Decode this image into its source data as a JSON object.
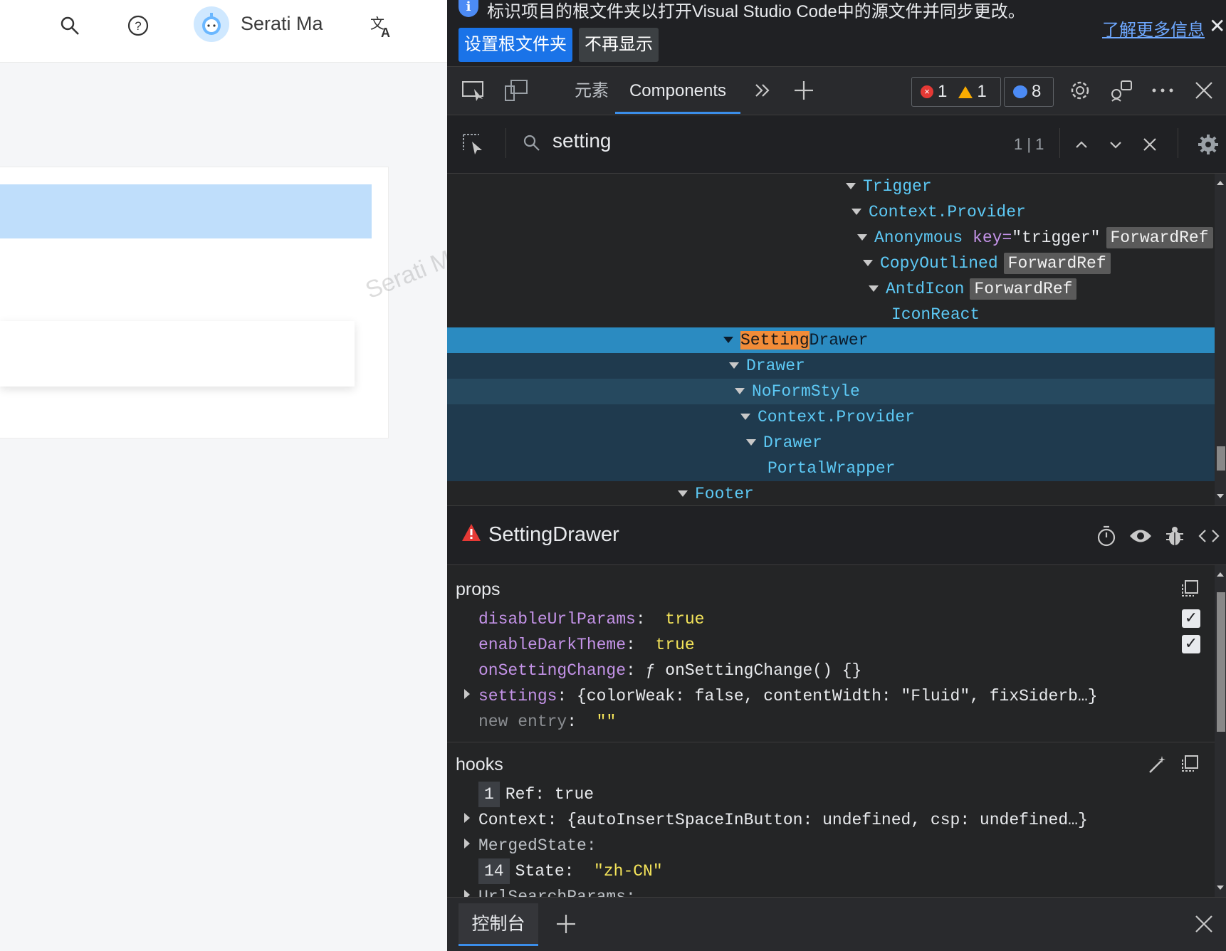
{
  "app": {
    "username": "Serati Ma",
    "watermark": "Serati M"
  },
  "devtools": {
    "infobar": {
      "message": "标识项目的根文件夹以打开Visual Studio Code中的源文件并同步更改。",
      "set_root_button": "设置根文件夹",
      "dont_show_button": "不再显示",
      "learn_more_link": "了解更多信息"
    },
    "tabs": {
      "elements": "元素",
      "components": "Components"
    },
    "badges": {
      "errors": "1",
      "warnings": "1",
      "messages": "8"
    },
    "search": {
      "query": "setting",
      "count": "1 | 1"
    },
    "tree": {
      "trigger": "Trigger",
      "context_provider_1": "Context.Provider",
      "anonymous": "Anonymous",
      "key_attr": "key=",
      "key_value": "\"trigger\"",
      "forward_ref": "ForwardRef",
      "copy_outlined": "CopyOutlined",
      "antd_icon": "AntdIcon",
      "icon_react": "IconReact",
      "setting_match": "Setting",
      "drawer_rest": "Drawer",
      "drawer_1": "Drawer",
      "no_form_style": "NoFormStyle",
      "context_provider_2": "Context.Provider",
      "drawer_2": "Drawer",
      "portal_wrapper": "PortalWrapper",
      "footer": "Footer"
    },
    "detail": {
      "title": "SettingDrawer",
      "props_title": "props",
      "props": {
        "disable_key": "disableUrlParams",
        "disable_val": "true",
        "enable_key": "enableDarkTheme",
        "enable_val": "true",
        "onsetting_key": "onSettingChange",
        "onsetting_val": "ƒ onSettingChange() {}",
        "settings_key": "settings",
        "settings_val": "{colorWeak: false, contentWidth: \"Fluid\", fixSiderb…}",
        "new_entry_key": "new entry",
        "new_entry_val": "\"\""
      },
      "hooks_title": "hooks",
      "hooks": {
        "ref_idx": "1",
        "ref_label": "Ref:",
        "ref_val": "true",
        "context_label": "Context:",
        "context_val": "{autoInsertSpaceInButton: undefined, csp: undefined…}",
        "merged_label": "MergedState:",
        "state_idx": "14",
        "state_label": "State:",
        "state_val": "\"zh-CN\"",
        "url_label": "UrlSearchParams:"
      }
    },
    "drawer": {
      "console_tab": "控制台"
    }
  }
}
